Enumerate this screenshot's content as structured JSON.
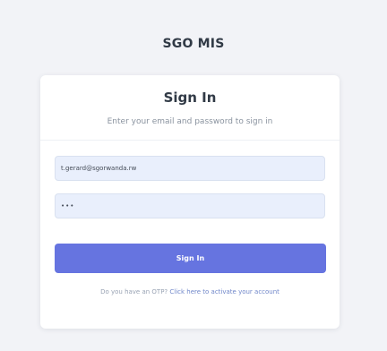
{
  "app": {
    "title": "SGO MIS"
  },
  "auth": {
    "heading": "Sign In",
    "subtitle": "Enter your email and password to sign in",
    "email_value": "t.gerard@sgorwanda.rw",
    "password_mask": "•••",
    "submit_label": "Sign In",
    "otp_prompt": "Do you have an OTP?",
    "otp_link": "Click here to activate your account"
  },
  "colors": {
    "background": "#f2f3f7",
    "card": "#ffffff",
    "accent": "#6674e0",
    "input_background": "#e9effc",
    "link": "#6f86c9"
  }
}
